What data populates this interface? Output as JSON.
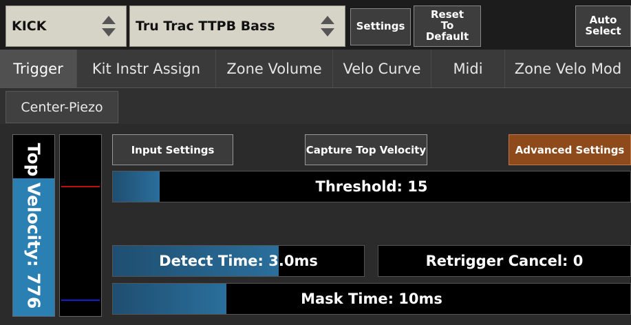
{
  "topbar": {
    "kit_select": "KICK",
    "instrument_select": "Tru Trac TTPB Bass",
    "settings_label": "Settings",
    "reset_line1": "Reset",
    "reset_line2": "To",
    "reset_line3": "Default",
    "auto_line1": "Auto",
    "auto_line2": "Select"
  },
  "tabs": [
    {
      "label": "Trigger",
      "active": true
    },
    {
      "label": "Kit Instr Assign"
    },
    {
      "label": "Zone Volume"
    },
    {
      "label": "Velo Curve"
    },
    {
      "label": "Midi"
    },
    {
      "label": "Zone Velo Mod"
    }
  ],
  "subtab": "Center-Piezo",
  "velocity": {
    "label": "Top Velocity: 776",
    "level": 0.76
  },
  "meter": {
    "threshold_level": 0.72,
    "baseline_level": 0.09,
    "threshold_color": "#c01010",
    "baseline_color": "#1020d0"
  },
  "buttons": {
    "input_settings": "Input Settings",
    "capture_top_velocity": "Capture Top Velocity",
    "advanced_settings": "Advanced Settings"
  },
  "sliders": {
    "threshold": {
      "label": "Threshold: 15",
      "fill": 0.09
    },
    "detect_time": {
      "label": "Detect Time: 3.0ms",
      "fill": 0.66
    },
    "retrigger_cancel": {
      "label": "Retrigger Cancel: 0",
      "fill": 0.0
    },
    "mask_time": {
      "label": "Mask Time: 10ms",
      "fill": 0.22
    }
  },
  "colors": {
    "accent_blue": "#2a7fb3",
    "advanced_orange": "#8e4a1b"
  }
}
